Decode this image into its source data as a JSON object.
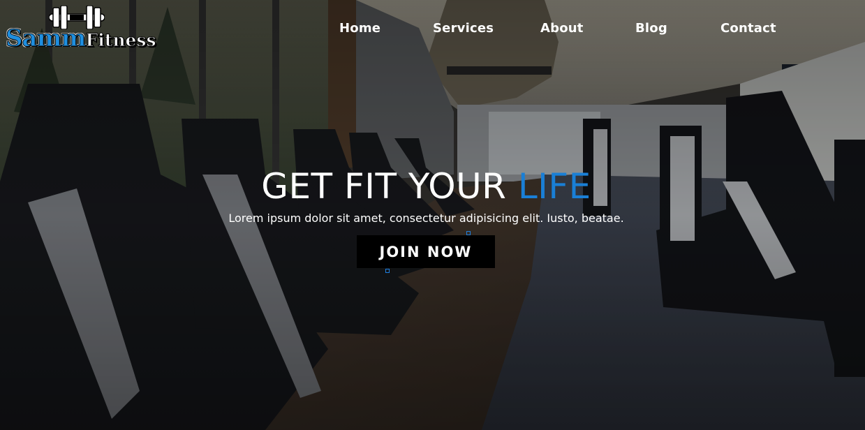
{
  "brand": {
    "name_part1": "Samm",
    "name_part2": "Fitness",
    "logo_icon": "dumbbell-icon",
    "colors": {
      "blue": "#1f8fe0",
      "white": "#ffffff"
    }
  },
  "nav": {
    "items": [
      {
        "label": "Home"
      },
      {
        "label": "Services"
      },
      {
        "label": "About"
      },
      {
        "label": "Blog"
      },
      {
        "label": "Contact"
      }
    ]
  },
  "hero": {
    "title_main": "GET FIT YOUR ",
    "title_accent": "LIFE",
    "subtitle": "Lorem ipsum dolor sit amet, consectetur adipisicing elit. Iusto, beatae.",
    "cta_label": "JOIN NOW",
    "background": "gym-interior-photo",
    "colors": {
      "accent": "#1a7fd6",
      "button_bg": "#000000",
      "text": "#ffffff"
    }
  }
}
